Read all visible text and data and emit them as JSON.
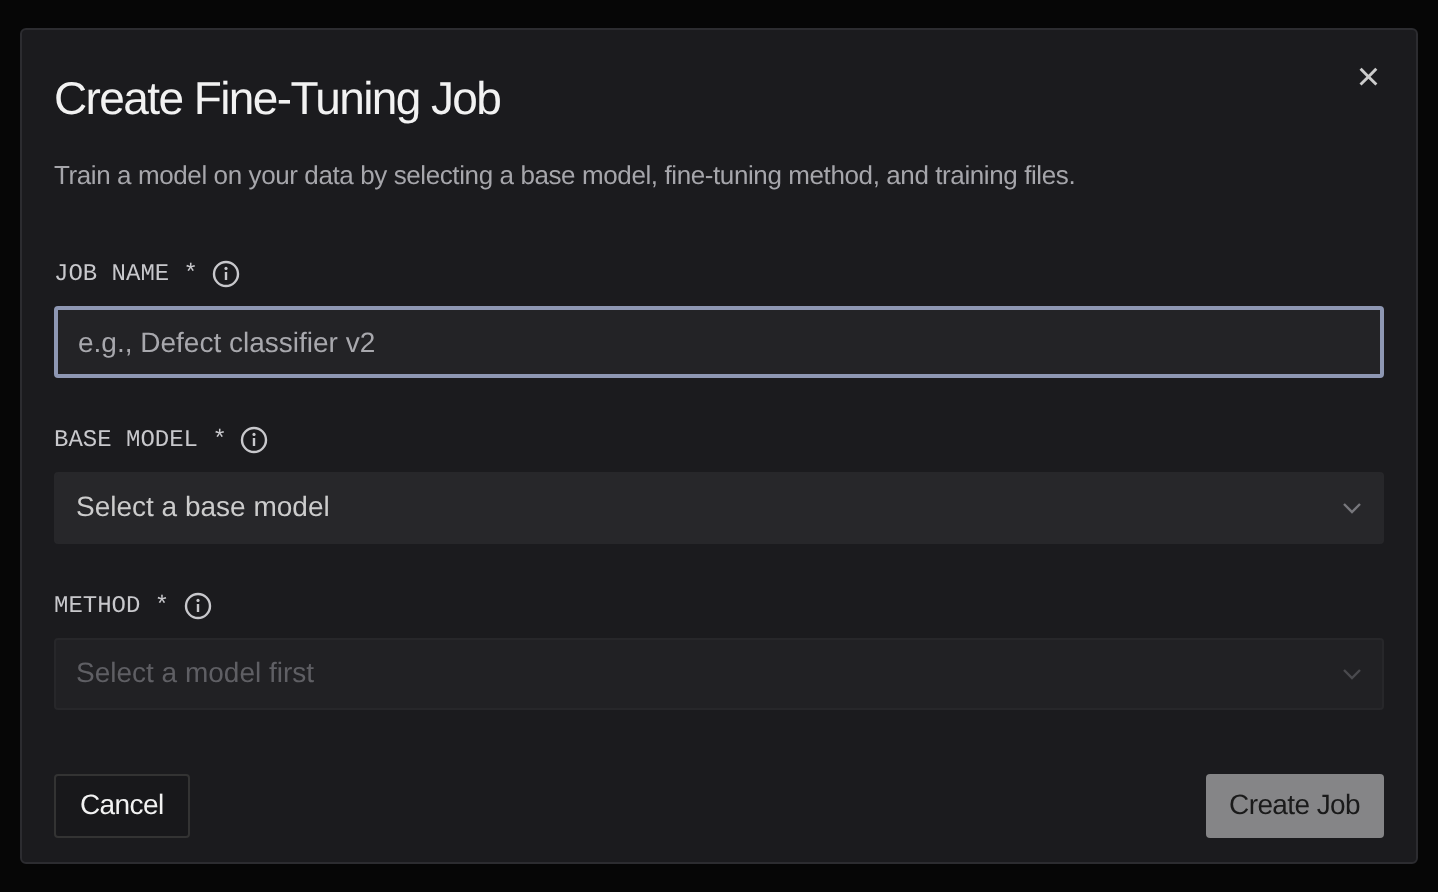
{
  "dialog": {
    "title": "Create Fine-Tuning Job",
    "description": "Train a model on your data by selecting a base model, fine-tuning method, and training files.",
    "close": "×"
  },
  "fields": [
    {
      "kind": "text",
      "label": "JOB NAME *",
      "placeholder": "e.g., Defect classifier v2",
      "focused": true,
      "disabled": false
    },
    {
      "kind": "select",
      "label": "BASE MODEL *",
      "placeholder": "Select a base model",
      "focused": false,
      "disabled": false
    },
    {
      "kind": "select",
      "label": "METHOD *",
      "placeholder": "Select a model first",
      "focused": false,
      "disabled": true
    }
  ],
  "buttons": [
    {
      "label": "Cancel",
      "kind": "secondary"
    },
    {
      "label": "Create Job",
      "kind": "primary",
      "disabled": true
    }
  ]
}
